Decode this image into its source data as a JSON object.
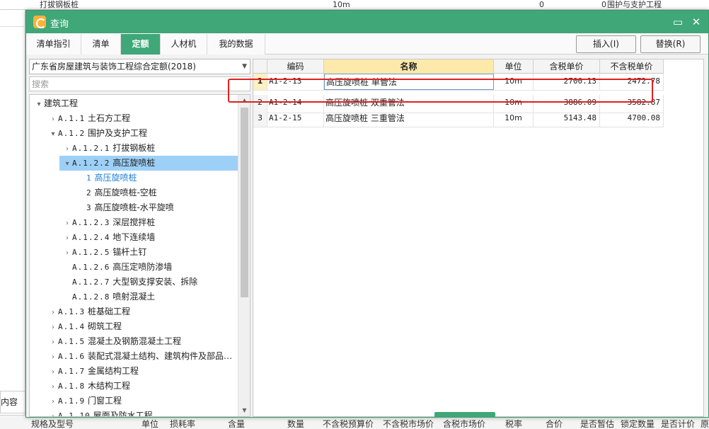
{
  "background": {
    "top_row": [
      "打拔钢板桩",
      "10m",
      "0",
      "0",
      "围护与支护工程"
    ],
    "left_label": "内容",
    "bottom_headers": [
      "规格及型号",
      "单位",
      "损耗率",
      "含量",
      "数量",
      "不含税预算价",
      "不含税市场价",
      "含税市场价",
      "税率",
      "合价",
      "是否暂估",
      "锁定数量",
      "是否计价",
      "原"
    ]
  },
  "dialog": {
    "title": "查询",
    "minimize": "▭",
    "close": "✕"
  },
  "tabs": [
    {
      "label": "清单指引",
      "active": false
    },
    {
      "label": "清单",
      "active": false
    },
    {
      "label": "定额",
      "active": true
    },
    {
      "label": "人材机",
      "active": false
    },
    {
      "label": "我的数据",
      "active": false
    }
  ],
  "toolbar": {
    "insert_label": "插入(I)",
    "replace_label": "替换(R)"
  },
  "library": {
    "selected": "广东省房屋建筑与装饰工程综合定额(2018)"
  },
  "search": {
    "placeholder": "搜索"
  },
  "tree": [
    {
      "code": "",
      "label": "建筑工程",
      "level": 0,
      "exp": "▾"
    },
    {
      "code": "A.1.1",
      "label": "土石方工程",
      "level": 1,
      "exp": "›"
    },
    {
      "code": "A.1.2",
      "label": "围护及支护工程",
      "level": 1,
      "exp": "▾"
    },
    {
      "code": "A.1.2.1",
      "label": "打拔钢板桩",
      "level": 2,
      "exp": "›"
    },
    {
      "code": "A.1.2.2",
      "label": "高压旋喷桩",
      "level": 2,
      "exp": "▾",
      "selected": true
    },
    {
      "code": "1",
      "label": "高压旋喷桩",
      "level": 3,
      "exp": "",
      "active": true
    },
    {
      "code": "2",
      "label": "高压旋喷桩-空桩",
      "level": 3,
      "exp": ""
    },
    {
      "code": "3",
      "label": "高压旋喷桩-水平旋喷",
      "level": 3,
      "exp": ""
    },
    {
      "code": "A.1.2.3",
      "label": "深层搅拌桩",
      "level": 2,
      "exp": "›"
    },
    {
      "code": "A.1.2.4",
      "label": "地下连续墙",
      "level": 2,
      "exp": "›"
    },
    {
      "code": "A.1.2.5",
      "label": "锚杆土钉",
      "level": 2,
      "exp": "›"
    },
    {
      "code": "A.1.2.6",
      "label": "高压定喷防渗墙",
      "level": 2,
      "exp": ""
    },
    {
      "code": "A.1.2.7",
      "label": "大型钢支撑安装、拆除",
      "level": 2,
      "exp": ""
    },
    {
      "code": "A.1.2.8",
      "label": "喷射混凝土",
      "level": 2,
      "exp": ""
    },
    {
      "code": "A.1.3",
      "label": "桩基础工程",
      "level": 1,
      "exp": "›"
    },
    {
      "code": "A.1.4",
      "label": "砌筑工程",
      "level": 1,
      "exp": "›"
    },
    {
      "code": "A.1.5",
      "label": "混凝土及钢筋混凝土工程",
      "level": 1,
      "exp": "›"
    },
    {
      "code": "A.1.6",
      "label": "装配式混凝土结构、建筑构件及部品…",
      "level": 1,
      "exp": "›"
    },
    {
      "code": "A.1.7",
      "label": "金属结构工程",
      "level": 1,
      "exp": "›"
    },
    {
      "code": "A.1.8",
      "label": "木结构工程",
      "level": 1,
      "exp": "›"
    },
    {
      "code": "A.1.9",
      "label": "门窗工程",
      "level": 1,
      "exp": "›"
    },
    {
      "code": "A.1.10",
      "label": "屋面及防水工程",
      "level": 1,
      "exp": "›"
    }
  ],
  "grid": {
    "headers": [
      "",
      "编码",
      "名称",
      "单位",
      "含税单价",
      "不含税单价"
    ],
    "rows": [
      {
        "idx": "1",
        "code": "A1-2-13",
        "name": "高压旋喷桩 单管法",
        "unit": "10m",
        "price_tax": "2700.13",
        "price_notax": "2472.78",
        "selected": true
      },
      {
        "idx": "2",
        "code": "A1-2-14",
        "name": "高压旋喷桩 双重管法",
        "unit": "10m",
        "price_tax": "3886.09",
        "price_notax": "3582.87"
      },
      {
        "idx": "3",
        "code": "A1-2-15",
        "name": "高压旋喷桩 三重管法",
        "unit": "10m",
        "price_tax": "5143.48",
        "price_notax": "4700.08"
      }
    ]
  },
  "colors": {
    "accent": "#3fa778",
    "selection": "#9dd0f7",
    "highlight_box": "#e02020"
  }
}
